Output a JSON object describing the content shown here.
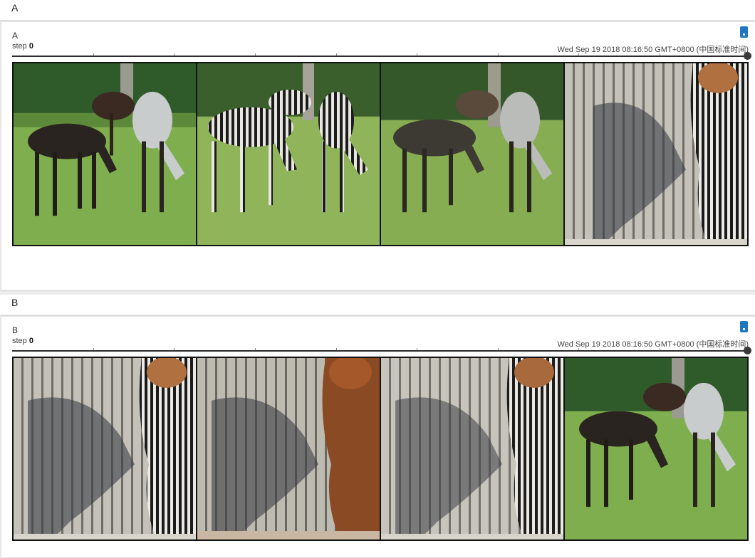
{
  "sections": [
    {
      "header": "A",
      "card": {
        "title": "A",
        "step_label": "step",
        "step_value": "0",
        "timestamp": "Wed Sep 19 2018 08:16:50 GMT+0800 (中国标准时间)"
      },
      "images": [
        "horses-pasture",
        "zebras-pasture",
        "horses-pasture-reconstructed",
        "fence-zebra"
      ]
    },
    {
      "header": "B",
      "card": {
        "title": "B",
        "step_label": "step",
        "step_value": "0",
        "timestamp": "Wed Sep 19 2018 08:16:50 GMT+0800 (中国标准时间)"
      },
      "images": [
        "fence-zebra",
        "fence-horse",
        "fence-zebra-reconstructed",
        "horses-pasture"
      ]
    }
  ],
  "colors": {
    "accent": "#1d78c1",
    "grass": "#7fae4e",
    "trees": "#2f5a2a",
    "fence": "#b8b6ae"
  }
}
